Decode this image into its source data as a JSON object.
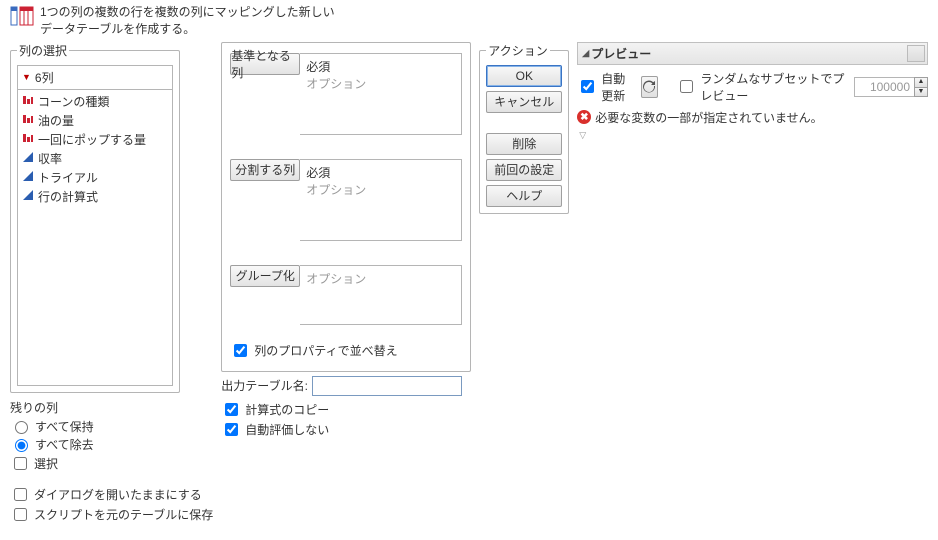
{
  "header": {
    "desc_l1": "1つの列の複数の行を複数の列にマッピングした新しい",
    "desc_l2": "データテーブルを作成する。"
  },
  "col_select": {
    "legend": "列の選択",
    "count_label": "6列",
    "items": [
      {
        "name": "コーンの種類",
        "icon": "nominal"
      },
      {
        "name": "油の量",
        "icon": "nominal"
      },
      {
        "name": "一回にポップする量",
        "icon": "nominal"
      },
      {
        "name": "収率",
        "icon": "continuous"
      },
      {
        "name": "トライアル",
        "icon": "continuous"
      },
      {
        "name": "行の計算式",
        "icon": "continuous"
      }
    ]
  },
  "roles": {
    "base": {
      "btn": "基準となる列",
      "req": "必須",
      "opt": "オプション"
    },
    "split": {
      "btn": "分割する列",
      "req": "必須",
      "opt": "オプション"
    },
    "group": {
      "btn": "グループ化",
      "opt": "オプション"
    }
  },
  "reorder_chk": "列のプロパティで並べ替え",
  "output": {
    "label": "出力テーブル名:",
    "copy_formula": "計算式のコピー",
    "no_autoeval": "自動評価しない"
  },
  "remaining": {
    "legend": "残りの列",
    "keep": "すべて保持",
    "drop": "すべて除去",
    "select": "選択"
  },
  "bottom": {
    "keep_open": "ダイアログを開いたままにする",
    "save_script": "スクリプトを元のテーブルに保存"
  },
  "actions": {
    "legend": "アクション",
    "ok": "OK",
    "cancel": "キャンセル",
    "remove": "削除",
    "recall": "前回の設定",
    "help": "ヘルプ"
  },
  "preview": {
    "title": "プレビュー",
    "auto": "自動更新",
    "subset": "ランダムなサブセットでプレビュー",
    "subset_n": "100000",
    "error": "必要な変数の一部が指定されていません。"
  }
}
